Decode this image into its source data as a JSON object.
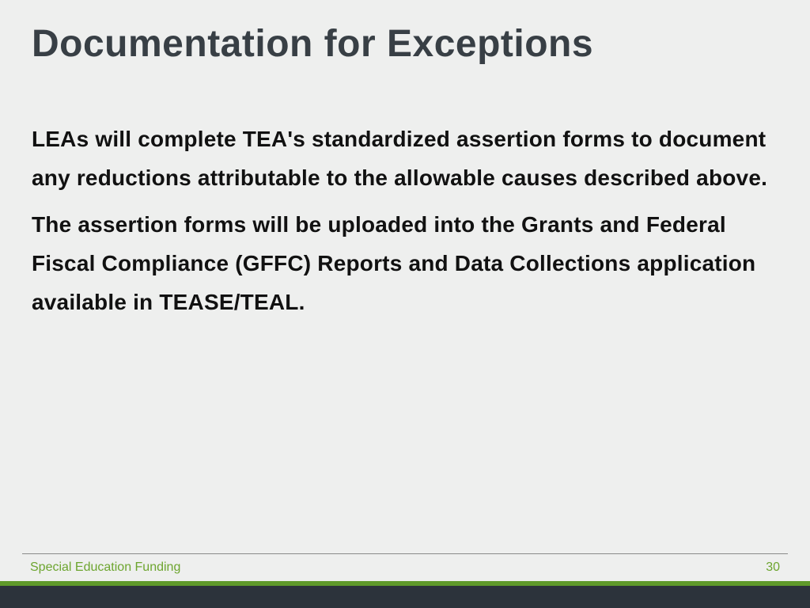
{
  "title": "Documentation for Exceptions",
  "body": {
    "p1": "LEAs will complete TEA's standardized assertion forms to document any reductions attributable to the allowable causes described above.",
    "p2": "The assertion forms will be uploaded into the Grants and Federal Fiscal Compliance (GFFC) Reports and Data Collections application available in TEASE/TEAL."
  },
  "footer": {
    "label": "Special Education Funding",
    "page": "30"
  }
}
